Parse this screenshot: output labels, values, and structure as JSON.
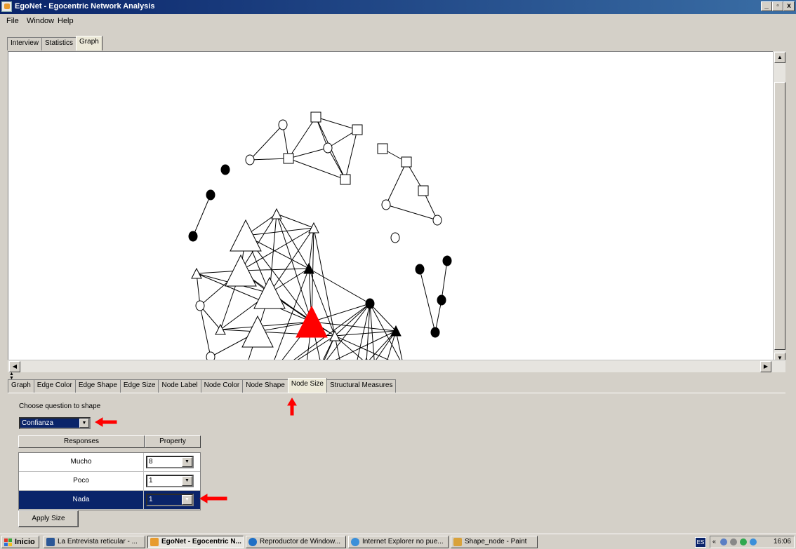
{
  "window": {
    "title": "EgoNet - Egocentric Network Analysis",
    "buttons": [
      "_",
      "▫",
      "x"
    ]
  },
  "menu": [
    "File",
    "Window",
    "Help"
  ],
  "top_tabs": [
    {
      "label": "Interview",
      "active": false
    },
    {
      "label": "Statistics",
      "active": false
    },
    {
      "label": "Graph",
      "active": true
    }
  ],
  "bottom_tabs": [
    {
      "label": "Graph",
      "active": false
    },
    {
      "label": "Edge Color",
      "active": false
    },
    {
      "label": "Edge Shape",
      "active": false
    },
    {
      "label": "Edge Size",
      "active": false
    },
    {
      "label": "Node Label",
      "active": false
    },
    {
      "label": "Node Color",
      "active": false
    },
    {
      "label": "Node Shape",
      "active": false
    },
    {
      "label": "Node Size",
      "active": true
    },
    {
      "label": "Structural Measures",
      "active": false
    }
  ],
  "node_size": {
    "choose_label": "Choose question to shape",
    "question_value": "Confianza",
    "col_responses": "Responses",
    "col_property": "Property",
    "rows": [
      {
        "response": "Mucho",
        "property": "8",
        "selected": false
      },
      {
        "response": "Poco",
        "property": "1",
        "selected": false
      },
      {
        "response": "Nada",
        "property": "1",
        "selected": true
      }
    ],
    "apply_label": "Apply Size"
  },
  "taskbar": {
    "start_label": "Inicio",
    "tasks": [
      {
        "label": "La Entrevista reticular - ...",
        "active": false,
        "color": "#2b5797"
      },
      {
        "label": "EgoNet - Egocentric N...",
        "active": true,
        "color": "#e79b2f"
      },
      {
        "label": "Reproductor de Window...",
        "active": false,
        "color": "#1f6fc5"
      },
      {
        "label": "Internet Explorer no pue...",
        "active": false,
        "color": "#3b8fd9"
      },
      {
        "label": "Shape_node - Paint",
        "active": false,
        "color": "#d9a23b"
      }
    ],
    "language": "ES",
    "clock": "16:06"
  },
  "annotations": {
    "arrow_color": "#ff0000"
  },
  "graph": {
    "ego_color": "#ff0000",
    "shapes": [
      "circle",
      "square",
      "triangle"
    ],
    "node_fills": [
      "#ffffff",
      "#000000"
    ]
  }
}
